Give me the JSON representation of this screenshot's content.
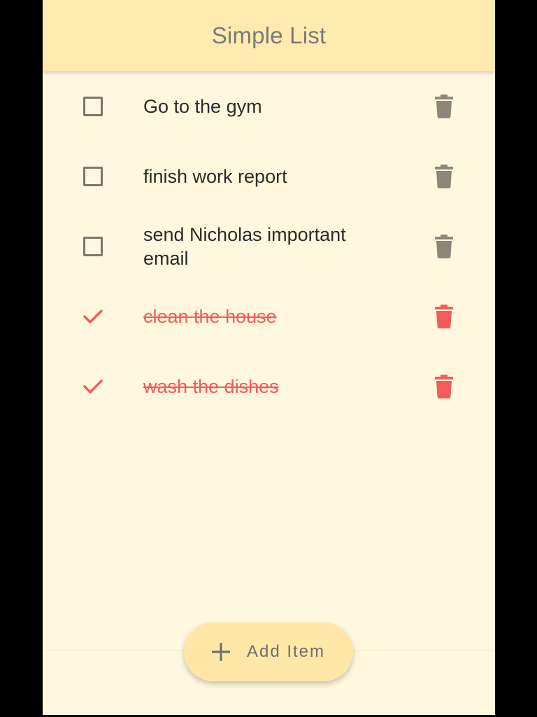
{
  "app": {
    "title": "Simple List"
  },
  "items": [
    {
      "text": "Go to the gym",
      "done": false
    },
    {
      "text": "finish work report",
      "done": false
    },
    {
      "text": "send Nicholas important email",
      "done": false
    },
    {
      "text": "clean the house",
      "done": true
    },
    {
      "text": "wash the dishes",
      "done": true
    }
  ],
  "fab": {
    "label": "Add Item",
    "icon": "plus-icon"
  },
  "colors": {
    "app_bar": "#FFEBB0",
    "background": "#FFF7DE",
    "pending": "#8E867A",
    "done": "#F25C5C",
    "fab": "#FFE7A8"
  }
}
